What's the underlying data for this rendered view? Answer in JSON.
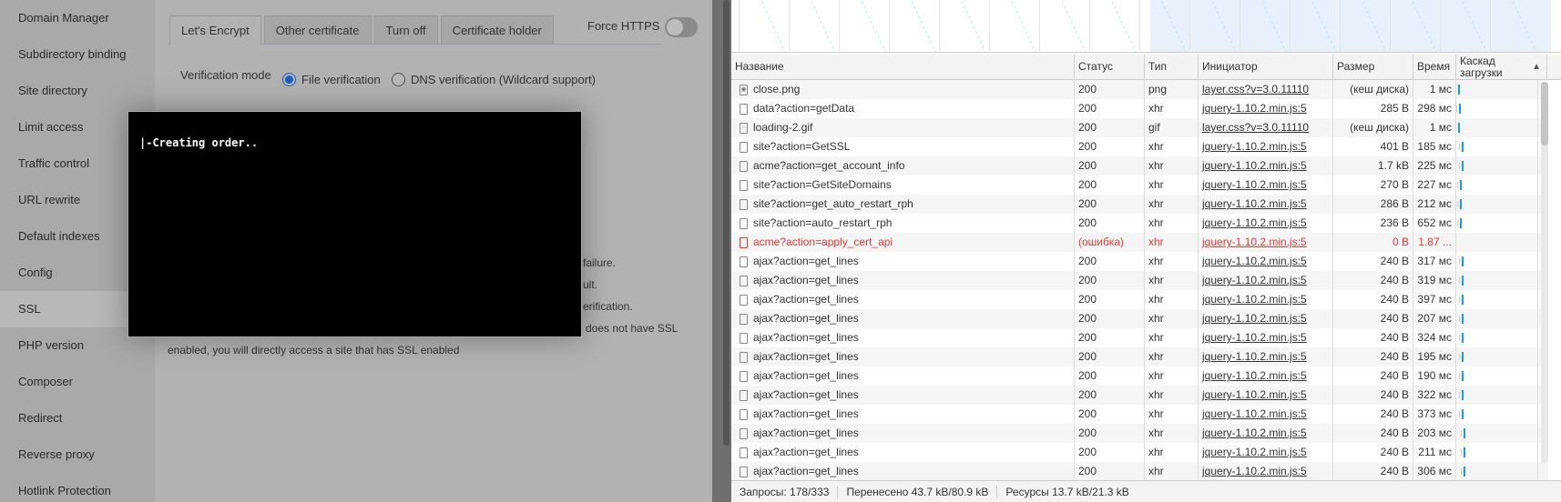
{
  "sidebar": {
    "items": [
      {
        "label": "Domain Manager"
      },
      {
        "label": "Subdirectory binding"
      },
      {
        "label": "Site directory"
      },
      {
        "label": "Limit access"
      },
      {
        "label": "Traffic control"
      },
      {
        "label": "URL rewrite"
      },
      {
        "label": "Default indexes"
      },
      {
        "label": "Config"
      },
      {
        "label": "SSL",
        "active": true
      },
      {
        "label": "PHP version"
      },
      {
        "label": "Composer"
      },
      {
        "label": "Redirect"
      },
      {
        "label": "Reverse proxy"
      },
      {
        "label": "Hotlink Protection"
      }
    ]
  },
  "ssl": {
    "tabs": [
      "Let's Encrypt",
      "Other certificate",
      "Turn off",
      "Certificate holder"
    ],
    "force_https_label": "Force HTTPS",
    "verification_label": "Verification mode",
    "radio_file": "File verification",
    "radio_dns": "DNS verification (Wildcard support)",
    "notes": [
      "failure.",
      "ult.",
      "erification.",
      "does not have SSL",
      "enabled, you will directly access a site that has SSL enabled"
    ]
  },
  "modal": {
    "text": "|-Creating order.."
  },
  "devtools": {
    "headers": {
      "name": "Название",
      "status": "Статус",
      "type": "Тип",
      "initiator": "Инициатор",
      "size": "Размер",
      "time": "Время",
      "waterfall": "Каскад загрузки",
      "sort_arrow": "▲"
    },
    "rows": [
      {
        "name": "close.png",
        "status": "200",
        "type": "png",
        "initiator": "layer.css?v=3.0.11110",
        "size": "(кеш диска)",
        "time": "1 мс"
      },
      {
        "name": "data?action=getData",
        "status": "200",
        "type": "xhr",
        "initiator": "jquery-1.10.2.min.js:5",
        "size": "285 B",
        "time": "298 мс"
      },
      {
        "name": "loading-2.gif",
        "status": "200",
        "type": "gif",
        "initiator": "layer.css?v=3.0.11110",
        "size": "(кеш диска)",
        "time": "1 мс"
      },
      {
        "name": "site?action=GetSSL",
        "status": "200",
        "type": "xhr",
        "initiator": "jquery-1.10.2.min.js:5",
        "size": "401 B",
        "time": "185 мс"
      },
      {
        "name": "acme?action=get_account_info",
        "status": "200",
        "type": "xhr",
        "initiator": "jquery-1.10.2.min.js:5",
        "size": "1.7 kB",
        "time": "225 мс"
      },
      {
        "name": "site?action=GetSiteDomains",
        "status": "200",
        "type": "xhr",
        "initiator": "jquery-1.10.2.min.js:5",
        "size": "270 B",
        "time": "227 мс"
      },
      {
        "name": "site?action=get_auto_restart_rph",
        "status": "200",
        "type": "xhr",
        "initiator": "jquery-1.10.2.min.js:5",
        "size": "286 B",
        "time": "212 мс"
      },
      {
        "name": "site?action=auto_restart_rph",
        "status": "200",
        "type": "xhr",
        "initiator": "jquery-1.10.2.min.js:5",
        "size": "236 B",
        "time": "652 мс"
      },
      {
        "name": "acme?action=apply_cert_api",
        "status": "(ошибка)",
        "type": "xhr",
        "initiator": "jquery-1.10.2.min.js:5",
        "size": "0 B",
        "time": "1.87 ...",
        "error": true
      },
      {
        "name": "ajax?action=get_lines",
        "status": "200",
        "type": "xhr",
        "initiator": "jquery-1.10.2.min.js:5",
        "size": "240 B",
        "time": "317 мс"
      },
      {
        "name": "ajax?action=get_lines",
        "status": "200",
        "type": "xhr",
        "initiator": "jquery-1.10.2.min.js:5",
        "size": "240 B",
        "time": "319 мс"
      },
      {
        "name": "ajax?action=get_lines",
        "status": "200",
        "type": "xhr",
        "initiator": "jquery-1.10.2.min.js:5",
        "size": "240 B",
        "time": "397 мс"
      },
      {
        "name": "ajax?action=get_lines",
        "status": "200",
        "type": "xhr",
        "initiator": "jquery-1.10.2.min.js:5",
        "size": "240 B",
        "time": "207 мс"
      },
      {
        "name": "ajax?action=get_lines",
        "status": "200",
        "type": "xhr",
        "initiator": "jquery-1.10.2.min.js:5",
        "size": "240 B",
        "time": "324 мс"
      },
      {
        "name": "ajax?action=get_lines",
        "status": "200",
        "type": "xhr",
        "initiator": "jquery-1.10.2.min.js:5",
        "size": "240 B",
        "time": "195 мс"
      },
      {
        "name": "ajax?action=get_lines",
        "status": "200",
        "type": "xhr",
        "initiator": "jquery-1.10.2.min.js:5",
        "size": "240 B",
        "time": "190 мс"
      },
      {
        "name": "ajax?action=get_lines",
        "status": "200",
        "type": "xhr",
        "initiator": "jquery-1.10.2.min.js:5",
        "size": "240 B",
        "time": "322 мс"
      },
      {
        "name": "ajax?action=get_lines",
        "status": "200",
        "type": "xhr",
        "initiator": "jquery-1.10.2.min.js:5",
        "size": "240 B",
        "time": "373 мс"
      },
      {
        "name": "ajax?action=get_lines",
        "status": "200",
        "type": "xhr",
        "initiator": "jquery-1.10.2.min.js:5",
        "size": "240 B",
        "time": "203 мс"
      },
      {
        "name": "ajax?action=get_lines",
        "status": "200",
        "type": "xhr",
        "initiator": "jquery-1.10.2.min.js:5",
        "size": "240 B",
        "time": "211 мс"
      },
      {
        "name": "ajax?action=get_lines",
        "status": "200",
        "type": "xhr",
        "initiator": "jquery-1.10.2.min.js:5",
        "size": "240 B",
        "time": "306 мс"
      }
    ],
    "footer": {
      "requests": "Запросы: 178/333",
      "transferred": "Перенесено 43.7 kB/80.9 kB",
      "resources": "Ресурсы 13.7 kB/21.3 kB"
    }
  }
}
